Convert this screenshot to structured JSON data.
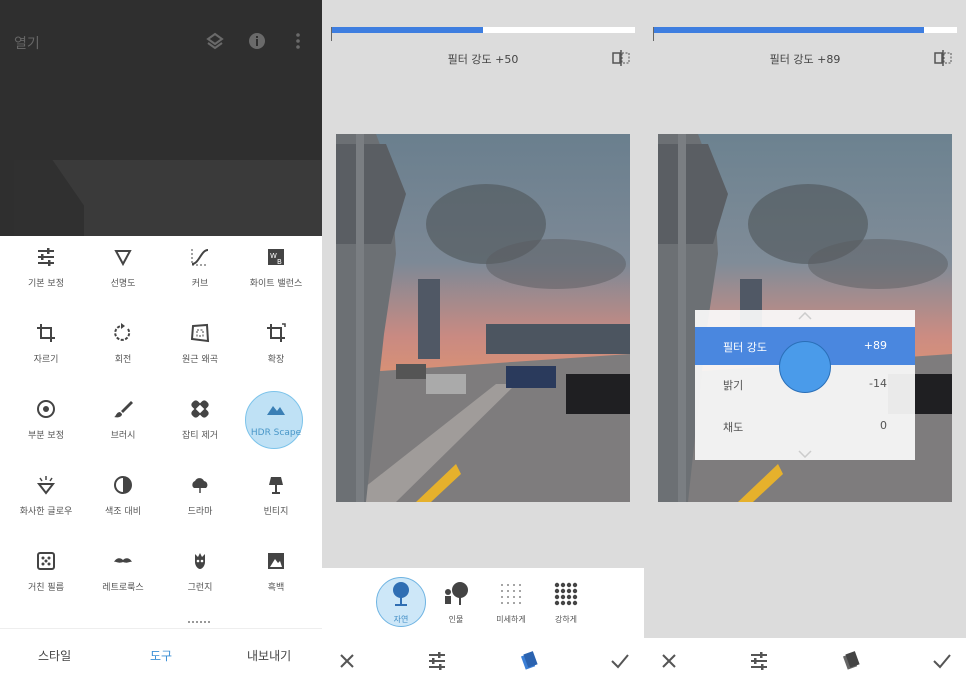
{
  "panel1": {
    "title": "열기",
    "header_icons": [
      "layers-icon",
      "info-icon",
      "more-vert-icon"
    ],
    "tools": [
      {
        "label": "기본 보정",
        "icon": "tune-icon"
      },
      {
        "label": "선명도",
        "icon": "triangle-down-icon"
      },
      {
        "label": "커브",
        "icon": "curves-icon"
      },
      {
        "label": "화이트 밸런스",
        "icon": "white-balance-icon"
      },
      {
        "label": "자르기",
        "icon": "crop-icon"
      },
      {
        "label": "회전",
        "icon": "rotate-icon"
      },
      {
        "label": "원근 왜곡",
        "icon": "perspective-icon"
      },
      {
        "label": "확장",
        "icon": "expand-icon"
      },
      {
        "label": "부분 보정",
        "icon": "selective-icon"
      },
      {
        "label": "브러시",
        "icon": "brush-icon"
      },
      {
        "label": "잡티 제거",
        "icon": "healing-icon"
      },
      {
        "label": "HDR Scape",
        "icon": "mountain-icon"
      },
      {
        "label": "화사한 글로우",
        "icon": "glow-icon"
      },
      {
        "label": "색조 대비",
        "icon": "tonal-contrast-icon"
      },
      {
        "label": "드라마",
        "icon": "cloud-icon"
      },
      {
        "label": "빈티지",
        "icon": "lamp-icon"
      },
      {
        "label": "거친 필름",
        "icon": "grainy-film-icon"
      },
      {
        "label": "레트로룩스",
        "icon": "mustache-icon"
      },
      {
        "label": "그런지",
        "icon": "grunge-icon"
      },
      {
        "label": "흑백",
        "icon": "black-white-icon"
      }
    ],
    "bottom_nav": {
      "styles": "스타일",
      "tools": "도구",
      "export": "내보내기"
    }
  },
  "panel2": {
    "filter_label": "필터 강도 +50",
    "slider_fraction": 0.5,
    "presets": [
      {
        "label": "자연",
        "icon": "nature-preset-icon"
      },
      {
        "label": "인물",
        "icon": "portrait-preset-icon"
      },
      {
        "label": "미세하게",
        "icon": "fine-dots-icon"
      },
      {
        "label": "강하게",
        "icon": "strong-dots-icon"
      }
    ]
  },
  "panel3": {
    "filter_label": "필터 강도 +89",
    "slider_fraction": 0.89,
    "adjustments": [
      {
        "name": "필터 강도",
        "value": "+89"
      },
      {
        "name": "밝기",
        "value": "-14"
      },
      {
        "name": "채도",
        "value": "0"
      }
    ]
  },
  "colors": {
    "accent": "#3e7ee0",
    "active_tab": "#3b8fd6",
    "highlight": "#bfe1f5"
  }
}
